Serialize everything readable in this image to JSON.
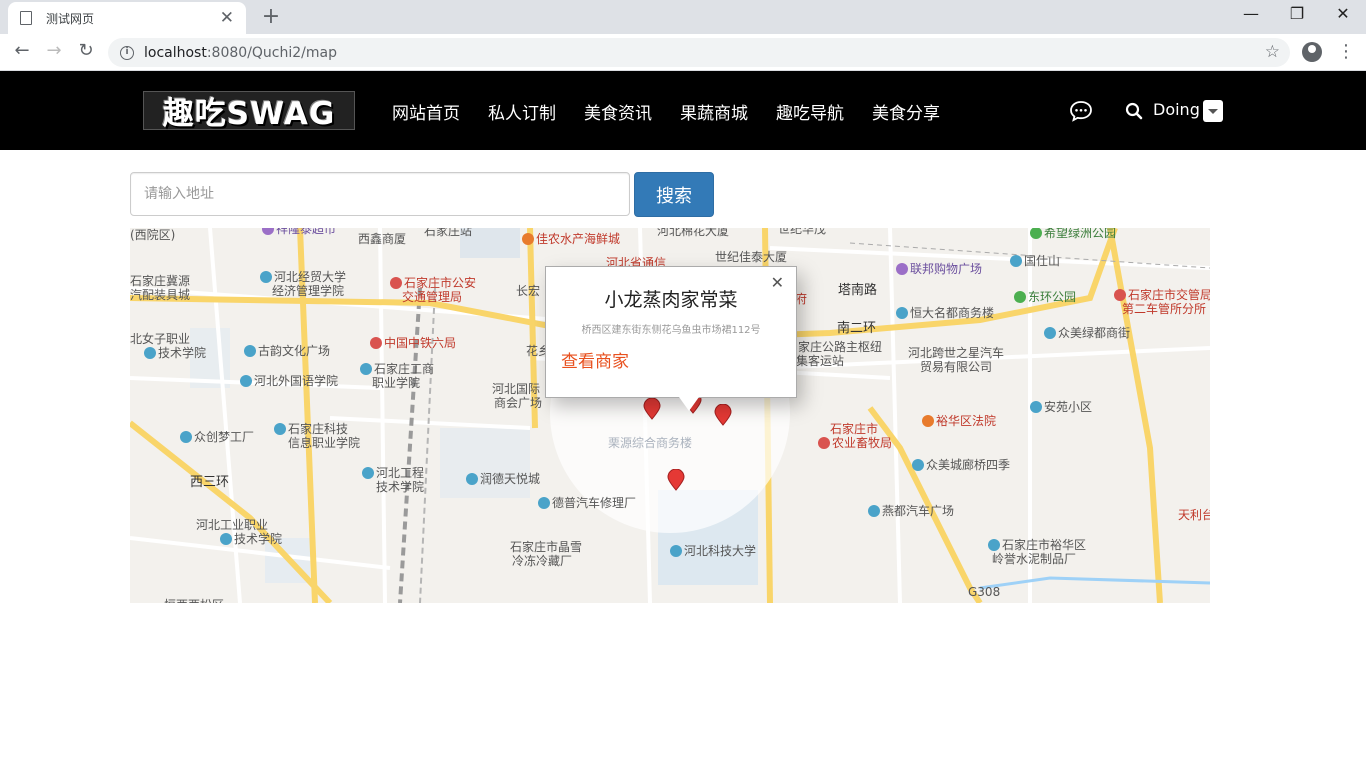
{
  "browser": {
    "tab_title": "测试网页",
    "url_host": "localhost",
    "url_path": ":8080/Quchi2/map"
  },
  "site": {
    "logo_text": "趣吃SWAG",
    "nav": [
      "网站首页",
      "私人订制",
      "美食资讯",
      "果蔬商城",
      "趣吃导航",
      "美食分享"
    ],
    "user": "Doing"
  },
  "search": {
    "placeholder": "请输入地址",
    "button": "搜索"
  },
  "popup": {
    "title": "小龙蒸肉家常菜",
    "address": "桥西区建东街东侧花乌鱼虫市场裙112号",
    "link": "查看商家"
  },
  "map": {
    "labels": [
      {
        "text": "(西院区)",
        "kind": "",
        "icon": ""
      },
      {
        "text": "祥隆泰超市",
        "kind": "purple",
        "icon": "p"
      },
      {
        "text": "西鑫商厦",
        "kind": "",
        "icon": ""
      },
      {
        "text": "石家庄站",
        "kind": "",
        "icon": ""
      },
      {
        "text": "佳农水产海鲜城",
        "kind": "red",
        "icon": "o"
      },
      {
        "text": "河北棉花大厦",
        "kind": "",
        "icon": ""
      },
      {
        "text": "世纪华茂",
        "kind": "",
        "icon": ""
      },
      {
        "text": "希望绿洲公园",
        "kind": "green",
        "icon": "g"
      },
      {
        "text": "石家庄冀源",
        "kind": "",
        "icon": ""
      },
      {
        "text": "汽配装具城",
        "kind": "",
        "icon": ""
      },
      {
        "text": "河北经贸大学",
        "kind": "",
        "icon": "b"
      },
      {
        "text": "经济管理学院",
        "kind": "",
        "icon": ""
      },
      {
        "text": "石家庄市公安",
        "kind": "red",
        "icon": "r"
      },
      {
        "text": "交通管理局",
        "kind": "red",
        "icon": ""
      },
      {
        "text": "长宏",
        "kind": "",
        "icon": ""
      },
      {
        "text": "河北省通信",
        "kind": "red",
        "icon": ""
      },
      {
        "text": "世纪佳泰大厦",
        "kind": "",
        "icon": ""
      },
      {
        "text": "联邦购物广场",
        "kind": "purple",
        "icon": "p"
      },
      {
        "text": "国仕山",
        "kind": "",
        "icon": "b"
      },
      {
        "text": "塔南路",
        "kind": "road",
        "icon": ""
      },
      {
        "text": "东环公园",
        "kind": "green",
        "icon": "g"
      },
      {
        "text": "石家庄市交管局",
        "kind": "red",
        "icon": "r"
      },
      {
        "text": "第二车管所分所",
        "kind": "red",
        "icon": ""
      },
      {
        "text": "府",
        "kind": "red",
        "icon": ""
      },
      {
        "text": "恒大名都商务楼",
        "kind": "",
        "icon": "b"
      },
      {
        "text": "南二环",
        "kind": "road",
        "icon": ""
      },
      {
        "text": "众美绿都商街",
        "kind": "",
        "icon": "b"
      },
      {
        "text": "北女子职业",
        "kind": "",
        "icon": ""
      },
      {
        "text": "技术学院",
        "kind": "",
        "icon": "b"
      },
      {
        "text": "古韵文化广场",
        "kind": "",
        "icon": "b"
      },
      {
        "text": "中国中铁六局",
        "kind": "red",
        "icon": "r"
      },
      {
        "text": "石家庄工商",
        "kind": "",
        "icon": "b"
      },
      {
        "text": "职业学院",
        "kind": "",
        "icon": ""
      },
      {
        "text": "花乡",
        "kind": "",
        "icon": ""
      },
      {
        "text": "家庄公路主枢纽",
        "kind": "",
        "icon": ""
      },
      {
        "text": "集客运站",
        "kind": "",
        "icon": ""
      },
      {
        "text": "河北跨世之星汽车",
        "kind": "",
        "icon": ""
      },
      {
        "text": "贸易有限公司",
        "kind": "",
        "icon": ""
      },
      {
        "text": "河北外国语学院",
        "kind": "",
        "icon": "b"
      },
      {
        "text": "河北国际",
        "kind": "",
        "icon": ""
      },
      {
        "text": "商会广场",
        "kind": "",
        "icon": ""
      },
      {
        "text": "安苑小区",
        "kind": "",
        "icon": "b"
      },
      {
        "text": "众创梦工厂",
        "kind": "",
        "icon": "b"
      },
      {
        "text": "石家庄科技",
        "kind": "",
        "icon": "b"
      },
      {
        "text": "信息职业学院",
        "kind": "",
        "icon": ""
      },
      {
        "text": "栗源综合商务楼",
        "kind": "faint",
        "icon": ""
      },
      {
        "text": "石家庄市",
        "kind": "red",
        "icon": ""
      },
      {
        "text": "农业畜牧局",
        "kind": "red",
        "icon": "r"
      },
      {
        "text": "裕华区法院",
        "kind": "red",
        "icon": "o"
      },
      {
        "text": "众美城廊桥四季",
        "kind": "",
        "icon": "b"
      },
      {
        "text": "西三环",
        "kind": "road",
        "icon": ""
      },
      {
        "text": "河北工程",
        "kind": "",
        "icon": "b"
      },
      {
        "text": "技术学院",
        "kind": "",
        "icon": ""
      },
      {
        "text": "润德天悦城",
        "kind": "",
        "icon": "b"
      },
      {
        "text": "德普汽车修理厂",
        "kind": "",
        "icon": "b"
      },
      {
        "text": "燕都汽车广场",
        "kind": "",
        "icon": "b"
      },
      {
        "text": "天利台",
        "kind": "red",
        "icon": ""
      },
      {
        "text": "河北工业职业",
        "kind": "",
        "icon": ""
      },
      {
        "text": "技术学院",
        "kind": "",
        "icon": "b"
      },
      {
        "text": "石家庄市晶雪",
        "kind": "",
        "icon": ""
      },
      {
        "text": "冷冻冷藏厂",
        "kind": "",
        "icon": ""
      },
      {
        "text": "河北科技大学",
        "kind": "",
        "icon": "b"
      },
      {
        "text": "石家庄市裕华区",
        "kind": "",
        "icon": "b"
      },
      {
        "text": "岭誉水泥制品厂",
        "kind": "",
        "icon": ""
      },
      {
        "text": "恒西西松区",
        "kind": "",
        "icon": ""
      },
      {
        "text": "G308",
        "kind": "",
        "icon": ""
      }
    ]
  }
}
